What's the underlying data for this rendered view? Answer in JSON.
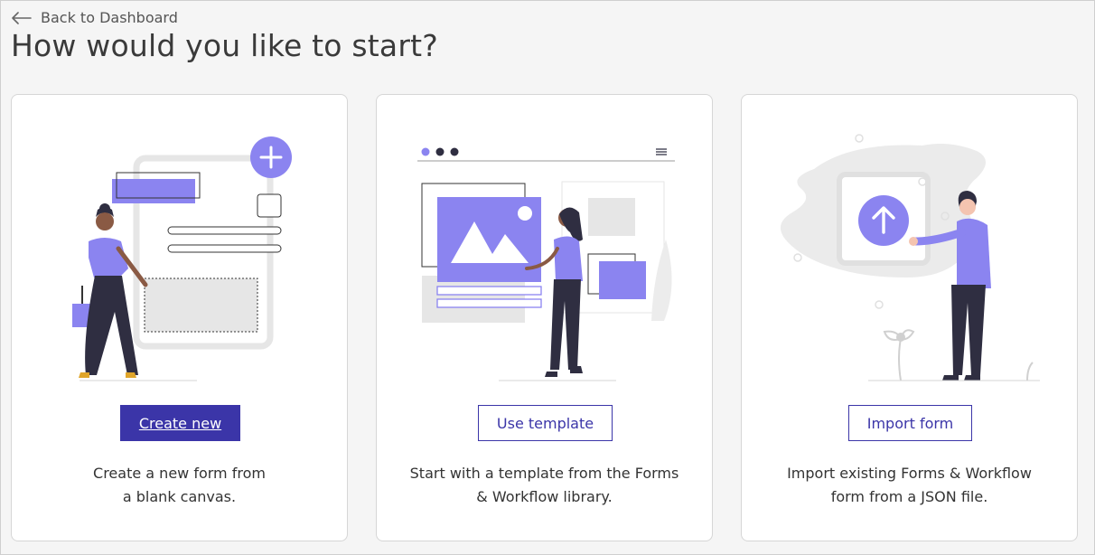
{
  "nav": {
    "back_label": "Back to Dashboard",
    "back_icon": "arrow-left-icon"
  },
  "page": {
    "title": "How would you like to start?"
  },
  "cards": [
    {
      "button_label": "Create new",
      "description_line1": "Create a new form from",
      "description_line2": "a blank canvas."
    },
    {
      "button_label": "Use template",
      "description_line1": "Start with a template from the Forms",
      "description_line2": "& Workflow library."
    },
    {
      "button_label": "Import form",
      "description_line1": "Import existing Forms & Workflow",
      "description_line2": "form from a JSON file."
    }
  ],
  "colors": {
    "accent": "#3b35a8",
    "illustration_purple": "#8b84f0",
    "dark": "#2f2e41",
    "light_gray": "#e6e6e6"
  }
}
